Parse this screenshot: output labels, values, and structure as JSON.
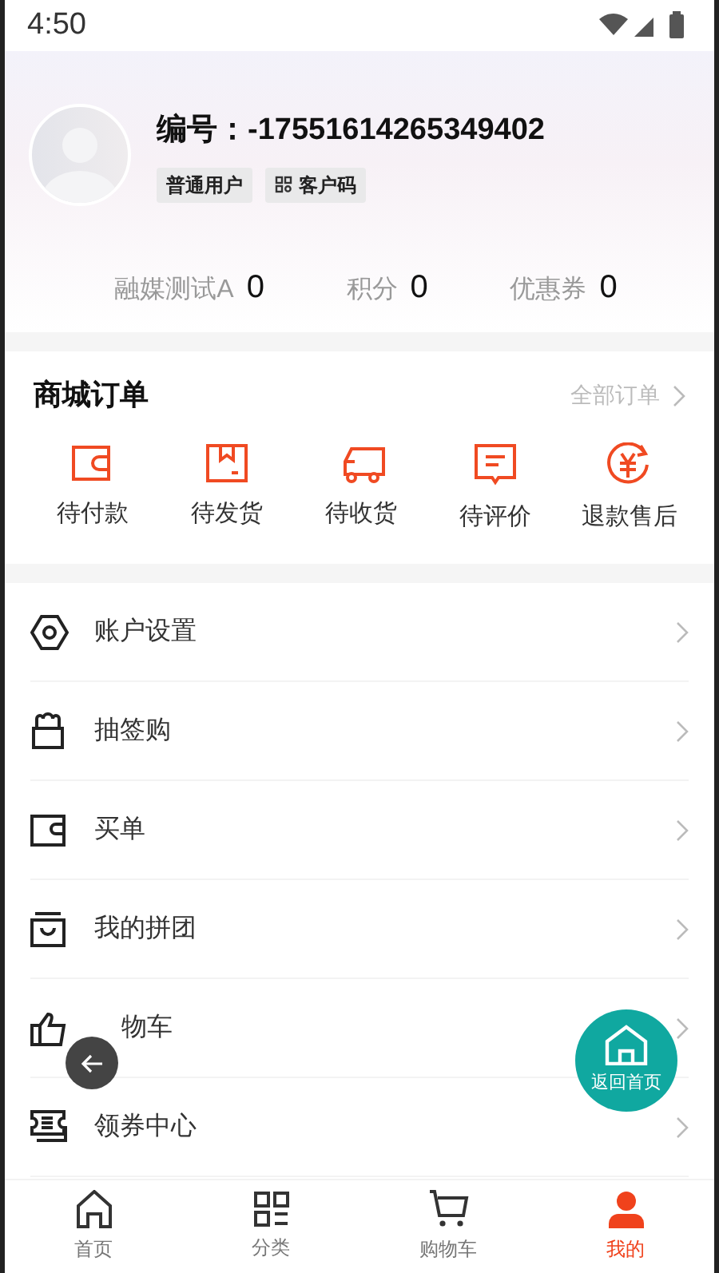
{
  "status_bar": {
    "time": "4:50"
  },
  "profile": {
    "id_label": "编号：-17551614265349402",
    "tags": [
      {
        "label": "普通用户",
        "kind": "plain"
      },
      {
        "label": "客户码",
        "kind": "qr"
      }
    ]
  },
  "stats": [
    {
      "label": "融媒测试A",
      "value": "0"
    },
    {
      "label": "积分",
      "value": "0"
    },
    {
      "label": "优惠券",
      "value": "0"
    }
  ],
  "orders": {
    "title": "商城订单",
    "all_link": "全部订单",
    "items": [
      {
        "label": "待付款"
      },
      {
        "label": "待发货"
      },
      {
        "label": "待收货"
      },
      {
        "label": "待评价"
      },
      {
        "label": "退款售后"
      }
    ]
  },
  "menu": [
    {
      "label": "账户设置"
    },
    {
      "label": "抽签购"
    },
    {
      "label": "买单"
    },
    {
      "label": "我的拼团"
    },
    {
      "label": "物车",
      "kind": "covered"
    },
    {
      "label": "领券中心"
    }
  ],
  "float_button": {
    "label": "返回首页"
  },
  "tab_bar": [
    {
      "label": "首页",
      "selected": false
    },
    {
      "label": "分类",
      "selected": false
    },
    {
      "label": "购物车",
      "selected": false
    },
    {
      "label": "我的",
      "selected": true
    }
  ]
}
